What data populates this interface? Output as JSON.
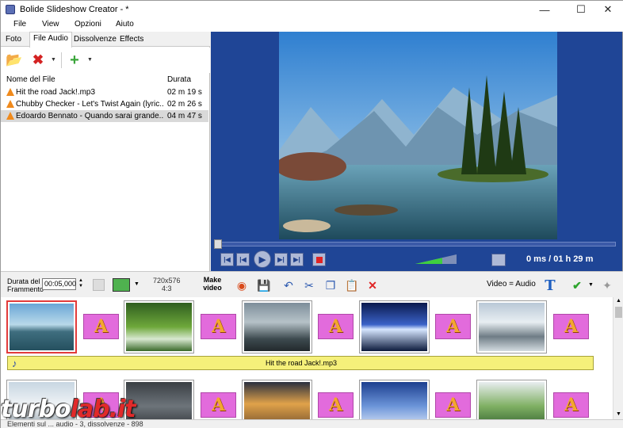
{
  "window": {
    "title": "Bolide Slideshow Creator - *"
  },
  "menu": [
    "File",
    "View",
    "Opzioni",
    "Aiuto"
  ],
  "tabs": [
    "Foto",
    "File Audio",
    "Dissolvenze",
    "Effects"
  ],
  "files": {
    "col_name": "Nome del File",
    "col_duration": "Durata",
    "rows": [
      {
        "name": "Hit the road Jack!.mp3",
        "duration": "02 m 19 s",
        "selected": false
      },
      {
        "name": "Chubby Checker - Let's Twist Again (lyric...",
        "duration": "02 m 26 s",
        "selected": false
      },
      {
        "name": "Edoardo Bennato - Quando sarai grande....",
        "duration": "04 m 47 s",
        "selected": true
      }
    ]
  },
  "player": {
    "time": "0 ms / 01 h 29 m",
    "progress": 0.0
  },
  "timeline": {
    "duration_label": "Durata del Frammento",
    "duration_value": "00:05,000",
    "resolution": "720x576",
    "aspect": "4:3",
    "make_video": "Make video",
    "video_audio": "Video = Audio",
    "audio_track": "Hit the road Jack!.mp3",
    "transition_letter": "A"
  },
  "status": {
    "text": "Elementi sul ... audio - 3, dissolvenze - 898"
  },
  "watermark": {
    "text": "turbolab.it"
  },
  "colors": {
    "preview_bg": "#1f4596",
    "audio_bar": "#f5f07a",
    "transition": "#e26bdc",
    "selected_frame": "#e23b3b"
  }
}
